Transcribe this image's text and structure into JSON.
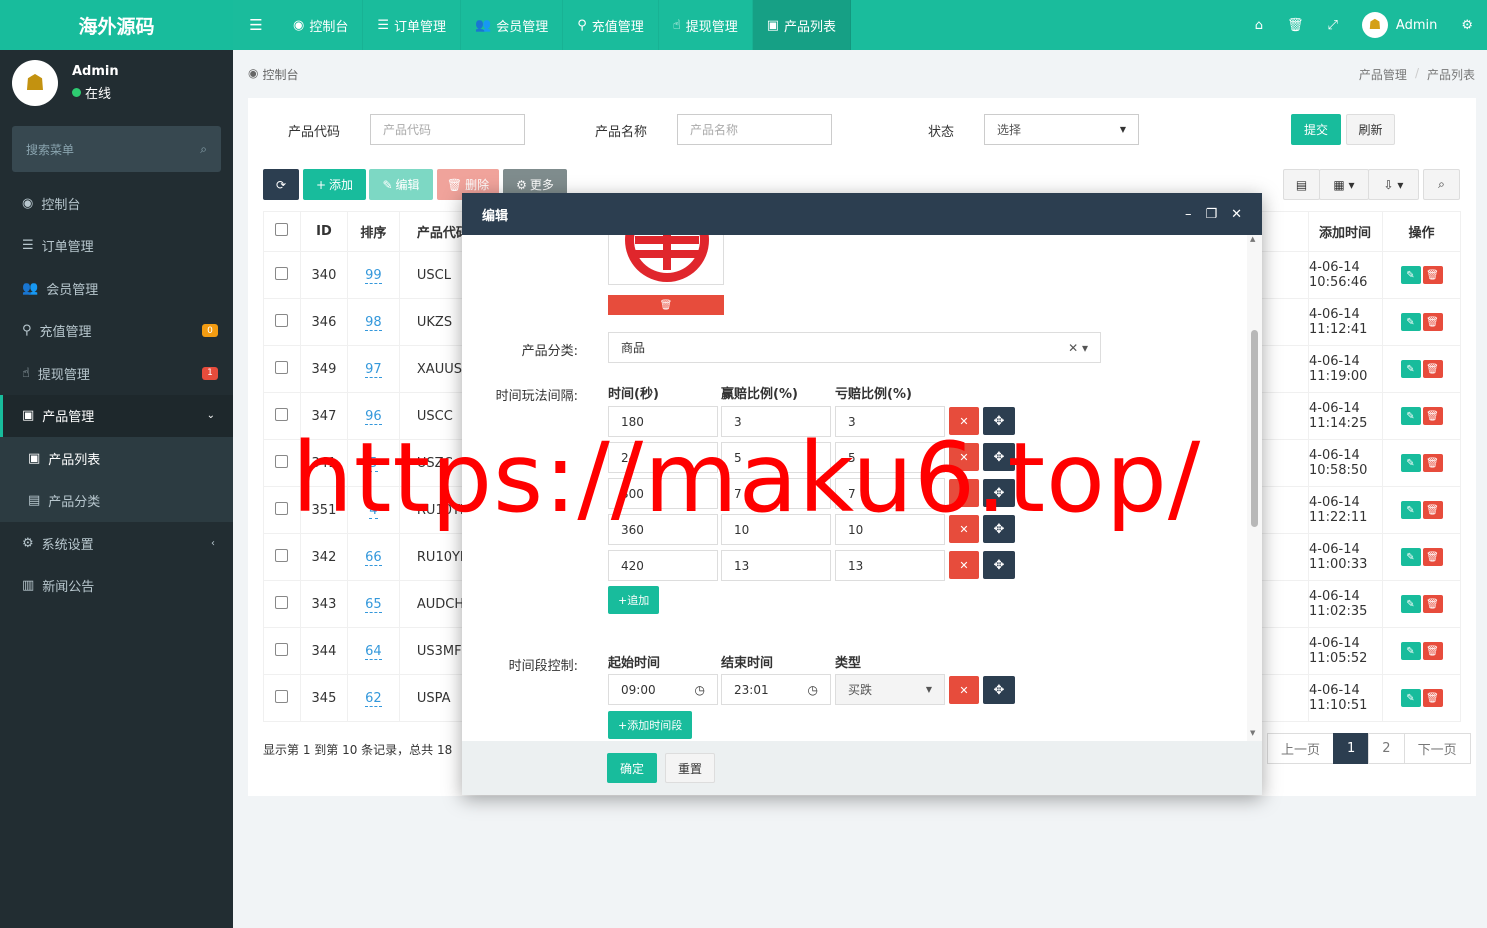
{
  "app": {
    "logo_text": "海外源码",
    "user_name": "Admin",
    "status_text": "在线"
  },
  "topnav": [
    {
      "icon": "dashboard-icon",
      "glyph": "◉",
      "label": "控制台"
    },
    {
      "icon": "list-icon",
      "glyph": "☰",
      "label": "订单管理"
    },
    {
      "icon": "users-icon",
      "glyph": "👥",
      "label": "会员管理"
    },
    {
      "icon": "plug-icon",
      "glyph": "⚲",
      "label": "充值管理"
    },
    {
      "icon": "hand-icon",
      "glyph": "☝",
      "label": "提现管理"
    },
    {
      "icon": "shopping-bag-icon",
      "glyph": "▣",
      "label": "产品列表"
    }
  ],
  "sidebar": {
    "search_placeholder": "搜索菜单",
    "items": [
      {
        "label": "控制台",
        "glyph": "◉"
      },
      {
        "label": "订单管理",
        "glyph": "☰"
      },
      {
        "label": "会员管理",
        "glyph": "👥"
      },
      {
        "label": "充值管理",
        "glyph": "⚲",
        "badge": "0"
      },
      {
        "label": "提现管理",
        "glyph": "☝",
        "badge": "1"
      },
      {
        "label": "产品管理",
        "glyph": "▣"
      },
      {
        "label": "产品列表",
        "glyph": "▣"
      },
      {
        "label": "产品分类",
        "glyph": "▤"
      },
      {
        "label": "系统设置",
        "glyph": "⚙"
      },
      {
        "label": "新闻公告",
        "glyph": "▥"
      }
    ]
  },
  "breadcrumb": {
    "current": "控制台",
    "trail": [
      "产品管理",
      "产品列表"
    ]
  },
  "filter": {
    "code_label": "产品代码",
    "code_placeholder": "产品代码",
    "name_label": "产品名称",
    "name_placeholder": "产品名称",
    "status_label": "状态",
    "status_value": "选择",
    "submit": "提交",
    "reset": "刷新"
  },
  "toolbar": {
    "add": "添加",
    "edit": "编辑",
    "delete": "删除",
    "more": "更多"
  },
  "table": {
    "headers": [
      "ID",
      "排序",
      "产品代码",
      "添加时间",
      "操作"
    ],
    "rows": [
      {
        "id": "340",
        "sort": "99",
        "code": "USCL",
        "time": "4-06-14 10:56:46"
      },
      {
        "id": "346",
        "sort": "98",
        "code": "UKZS",
        "time": "4-06-14 11:12:41"
      },
      {
        "id": "349",
        "sort": "97",
        "code": "XAUUS",
        "time": "4-06-14 11:19:00"
      },
      {
        "id": "347",
        "sort": "96",
        "code": "USCC",
        "time": "4-06-14 11:14:25"
      },
      {
        "id": "341",
        "sort": "5",
        "code": "USZC",
        "time": "4-06-14 10:58:50"
      },
      {
        "id": "351",
        "sort": "4",
        "code": "RU10YI",
        "time": "4-06-14 11:22:11"
      },
      {
        "id": "342",
        "sort": "66",
        "code": "RU10YI",
        "time": "4-06-14 11:00:33"
      },
      {
        "id": "343",
        "sort": "65",
        "code": "AUDCH",
        "time": "4-06-14 11:02:35"
      },
      {
        "id": "344",
        "sort": "64",
        "code": "US3MF",
        "time": "4-06-14 11:05:52"
      },
      {
        "id": "345",
        "sort": "62",
        "code": "USPA",
        "time": "4-06-14 11:10:51"
      }
    ],
    "summary": "显示第 1 到第 10 条记录，总共 18"
  },
  "pager": {
    "prev": "上一页",
    "pages": [
      "1",
      "2"
    ],
    "next": "下一页"
  },
  "modal": {
    "title": "编辑",
    "category_label": "产品分类:",
    "category_value": "商品",
    "play_label": "时间玩法间隔:",
    "play_headers": [
      "时间(秒)",
      "赢赔比例(%)",
      "亏赔比例(%)"
    ],
    "play_rows": [
      [
        "180",
        "3",
        "3"
      ],
      [
        "24",
        "5",
        "5"
      ],
      [
        "300",
        "7",
        "7"
      ],
      [
        "360",
        "10",
        "10"
      ],
      [
        "420",
        "13",
        "13"
      ]
    ],
    "add_row": "追加",
    "period_label": "时间段控制:",
    "period_headers": [
      "起始时间",
      "结束时间",
      "类型"
    ],
    "period_row": {
      "start": "09:00",
      "end": "23:01",
      "type": "买跌"
    },
    "add_period": "添加时间段",
    "ok": "确定",
    "reset": "重置"
  },
  "watermark": "https://maku6.top/",
  "colors": {
    "primary": "#18bc9c",
    "dark": "#2c3e50",
    "danger": "#e74c3c",
    "sidebar": "#222d32"
  }
}
